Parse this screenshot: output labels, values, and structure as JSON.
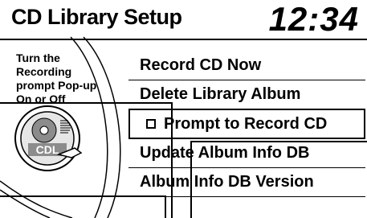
{
  "header": {
    "title": "CD Library Setup",
    "clock": "12:34"
  },
  "help": {
    "text": "Turn the Recording prompt Pop-up On or Off"
  },
  "cd_icon": {
    "label": "CDL",
    "icon": "cd-disc-icon"
  },
  "menu": {
    "items": [
      {
        "label": "Record CD Now"
      },
      {
        "label": "Delete Library Album"
      },
      {
        "label": "Prompt to Record CD",
        "checkbox": true,
        "checked": false,
        "selected": true
      },
      {
        "label": "Update Album Info DB"
      },
      {
        "label": "Album Info DB Version"
      }
    ]
  }
}
